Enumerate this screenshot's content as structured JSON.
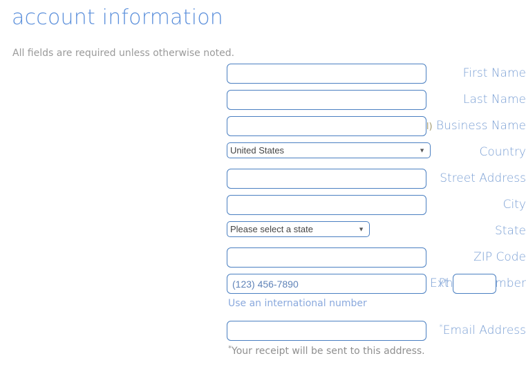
{
  "header": {
    "title": "account information",
    "subtitle": "All fields are required unless otherwise noted."
  },
  "form": {
    "first_name": {
      "label": "First Name",
      "value": "",
      "placeholder": ""
    },
    "last_name": {
      "label": "Last Name",
      "value": "",
      "placeholder": ""
    },
    "business_name": {
      "optional_tag": "(optional)",
      "label": "Business Name",
      "value": "",
      "placeholder": ""
    },
    "country": {
      "label": "Country",
      "selected": "United States",
      "options": [
        "United States"
      ],
      "arrow": "dropdown-arrow"
    },
    "street_address": {
      "label": "Street Address",
      "value": "",
      "placeholder": ""
    },
    "city": {
      "label": "City",
      "value": "",
      "placeholder": ""
    },
    "state": {
      "label": "State",
      "selected": "Please select a state",
      "options": [
        "Please select a state"
      ],
      "arrow": "dropdown-arrow"
    },
    "zip_code": {
      "label": "ZIP Code",
      "value": "",
      "placeholder": ""
    },
    "phone": {
      "label": "Phone Number",
      "value": "",
      "placeholder": "(123) 456-7890",
      "ext_label": "Ext",
      "ext_value": "",
      "hint_link": "Use an international number"
    },
    "email": {
      "star": "*",
      "label": "Email Address",
      "value": "",
      "placeholder": "",
      "note_star": "*",
      "note": "Your receipt will be sent to this address."
    }
  },
  "colors": {
    "title": "#5b8fdb",
    "label": "#7a9fd4",
    "optional": "#a39a6e",
    "border": "#4a7fc1",
    "muted": "#9a9a9a",
    "link": "#8aa9dd"
  }
}
